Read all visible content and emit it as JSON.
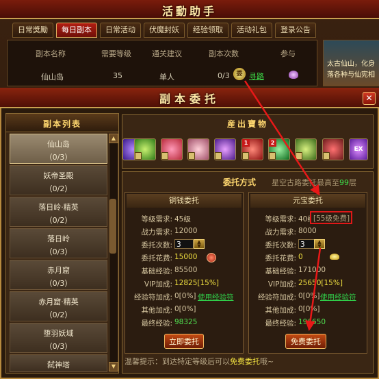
{
  "background_panel": {
    "title": "活動助手",
    "tabs": [
      {
        "label": "日常獎勵",
        "active": false
      },
      {
        "label": "每日副本",
        "active": true
      },
      {
        "label": "日常活动",
        "active": false
      },
      {
        "label": "伏魔封妖",
        "active": false
      },
      {
        "label": "经验领取",
        "active": false
      },
      {
        "label": "活动礼包",
        "active": false
      },
      {
        "label": "登录公告",
        "active": false
      }
    ],
    "table": {
      "columns": [
        "副本名称",
        "需要等级",
        "通关建议",
        "副本次数",
        "参与"
      ],
      "row": {
        "name": "仙山岛",
        "level": "35",
        "suggestion": "单人",
        "count": "0/3",
        "icon_text": "委",
        "link": "寻路"
      }
    },
    "right_text_line1": "太古仙山，化身",
    "right_text_line2": "落各种与仙宪相"
  },
  "dialog": {
    "title": "副本委托",
    "close_icon": "close-icon",
    "list_title": "副本列表",
    "list": [
      {
        "name": "仙山岛",
        "count": "（0/3）",
        "selected": true
      },
      {
        "name": "妖帝圣殿",
        "count": "（0/2）",
        "selected": false
      },
      {
        "name": "落日岭·精英",
        "count": "（0/2）",
        "selected": false
      },
      {
        "name": "落日岭",
        "count": "（0/3）",
        "selected": false
      },
      {
        "name": "赤月窟",
        "count": "（0/3）",
        "selected": false
      },
      {
        "name": "赤月窟·精英",
        "count": "（0/2）",
        "selected": false
      },
      {
        "name": "堕羽妖域",
        "count": "（0/3）",
        "selected": false
      },
      {
        "name": "弑神塔",
        "count": "",
        "selected": false
      }
    ],
    "treasure_title": "産出寶物",
    "treasure_items": [
      {
        "icon": "purple-gem-icon",
        "badge": ""
      },
      {
        "icon": "green-pet-icon",
        "badge": ""
      },
      {
        "icon": "pink-pet-icon",
        "badge": ""
      },
      {
        "icon": "pig-pet-icon",
        "badge": ""
      },
      {
        "icon": "purple-claw-icon",
        "badge": ""
      },
      {
        "icon": "red-gem-icon",
        "badge": "1"
      },
      {
        "icon": "green-gem-icon",
        "badge": "2"
      },
      {
        "icon": "fruit-box-icon",
        "badge": ""
      },
      {
        "icon": "cherry-box-icon",
        "badge": ""
      },
      {
        "icon": "gem-box-icon",
        "badge": ""
      },
      {
        "icon": "exp-icon",
        "badge": ""
      }
    ],
    "mode_title": "委托方式",
    "mode_note_prefix": "星空古路委托最高至",
    "mode_note_num": "99",
    "mode_note_suffix": "层",
    "copper": {
      "title": "铜钱委托",
      "level_label": "等级需求:",
      "level_value": "45级",
      "power_label": "战力需求:",
      "power_value": "12000",
      "times_label": "委托次数:",
      "times_value": "3",
      "cost_label": "委托花费:",
      "cost_value": "15000",
      "base_label": "基础经验:",
      "base_value": "85500",
      "vip_label": "VIP加成:",
      "vip_value": "12825[15%]",
      "talisman_label": "经验符加成:",
      "talisman_value": "0[0%]",
      "talisman_link": "使用经验符",
      "other_label": "其他加成:",
      "other_value": "0[0%]",
      "final_label": "最终经验:",
      "final_value": "98325",
      "button": "立即委托"
    },
    "ingot": {
      "title": "元宝委托",
      "level_label": "等级需求:",
      "level_value": "40级",
      "level_free": "[55级免费]",
      "power_label": "战力需求:",
      "power_value": "8000",
      "times_label": "委托次数:",
      "times_value": "3",
      "cost_label": "委托花费:",
      "cost_value": "0",
      "base_label": "基础经验:",
      "base_value": "171000",
      "vip_label": "VIP加成:",
      "vip_value": "25650[15%]",
      "talisman_label": "经验符加成:",
      "talisman_value": "0[0%]",
      "talisman_link": "使用经验符",
      "other_label": "其他加成:",
      "other_value": "0[0%]",
      "final_label": "最终经验:",
      "final_value": "196650",
      "button": "免费委托"
    },
    "tip_prefix": "温馨提示：到达特定等级后可以",
    "tip_highlight": "免费委托",
    "tip_suffix": "哦~"
  },
  "colors": {
    "annotation": "#e81818",
    "green_text": "#3ee04a",
    "yellow_text": "#f0e040"
  }
}
